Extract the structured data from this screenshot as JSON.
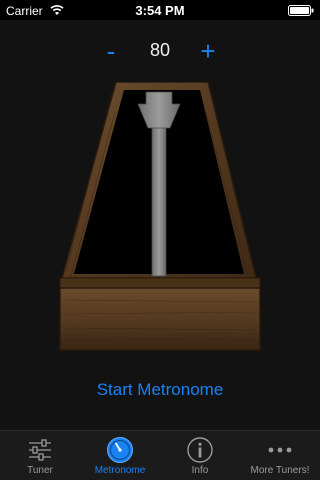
{
  "status_bar": {
    "carrier": "Carrier",
    "time": "3:54 PM",
    "wifi_icon": "wifi-icon",
    "battery_icon": "battery-icon"
  },
  "tempo": {
    "minus_label": "-",
    "value": "80",
    "plus_label": "+"
  },
  "start_label": "Start Metronome",
  "colors": {
    "accent": "#1a82f2",
    "background": "#121212",
    "tab_bar": "#1b1b1b",
    "wood": "#5a3f24"
  },
  "tabs": [
    {
      "label": "Tuner",
      "icon": "sliders-icon",
      "active": false
    },
    {
      "label": "Metronome",
      "icon": "metronome-dial-icon",
      "active": true
    },
    {
      "label": "Info",
      "icon": "info-icon",
      "active": false
    },
    {
      "label": "More Tuners!",
      "icon": "more-dots-icon",
      "active": false
    }
  ]
}
